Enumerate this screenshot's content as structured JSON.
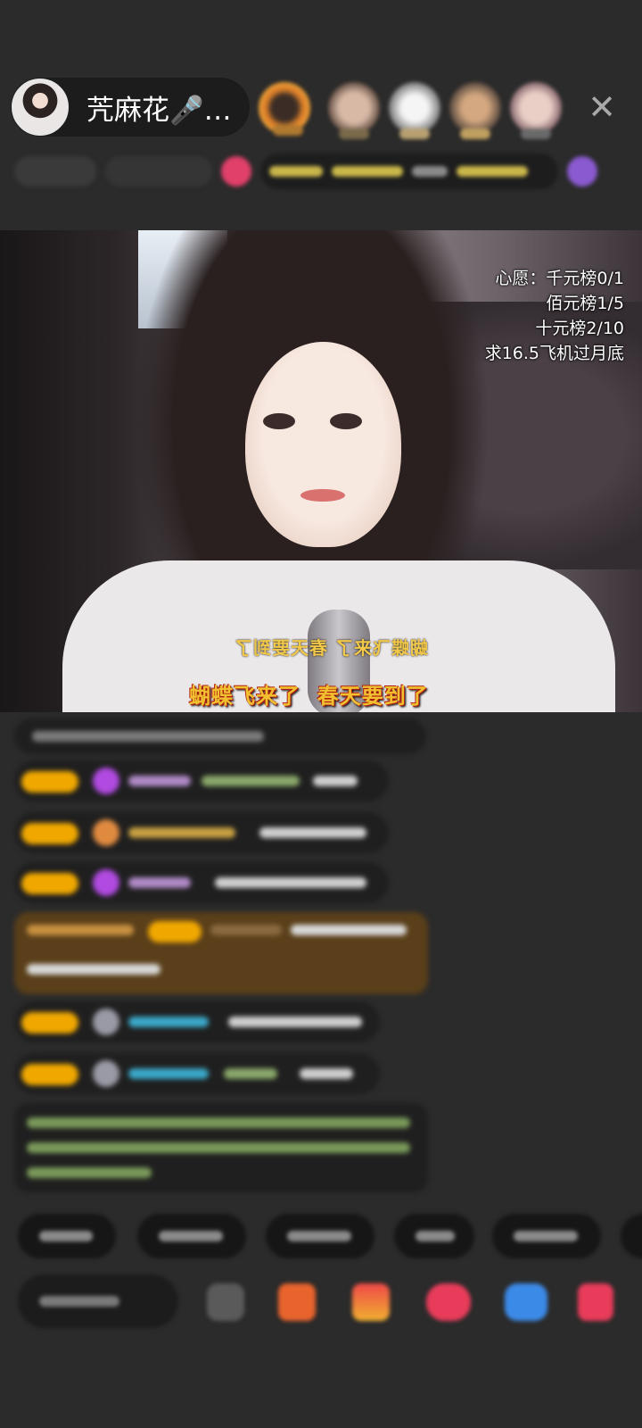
{
  "host": {
    "name": "苀麻花🎤…"
  },
  "viewer_avatars": [
    "viewer-1",
    "viewer-2",
    "viewer-3",
    "viewer-4",
    "viewer-5"
  ],
  "close_icon": "close-icon",
  "video": {
    "wishes": [
      "心愿：千元榜0/1",
      "佰元榜1/5",
      "十元榜2/10",
      "求16.5飞机过月底"
    ],
    "lyric": "蝴蝶飞来了  春天要到了",
    "lyric_mirror": "蝴蝶飞来了  春天要到了"
  },
  "colors": {
    "background": "#2b2b2b",
    "badge_yellow": "#f0a800",
    "lyric_yellow": "#f0c030",
    "lyric_outline": "#b02010"
  }
}
